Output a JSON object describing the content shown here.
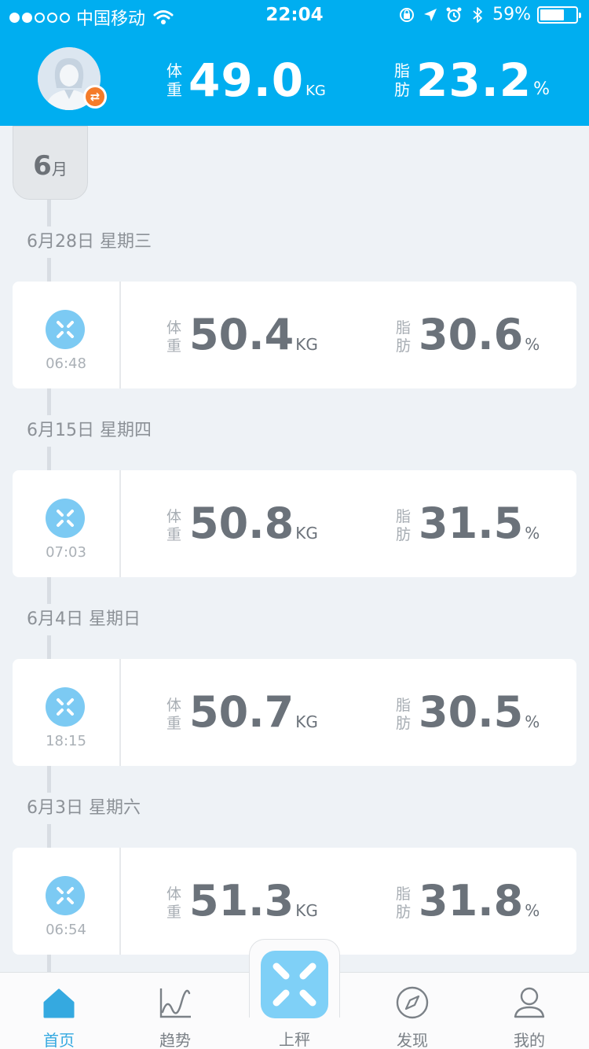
{
  "status_bar": {
    "carrier": "中国移动",
    "time": "22:04",
    "battery": "59%",
    "battery_level": 0.59,
    "signal_dots_on": 2,
    "signal_dots_total": 5
  },
  "header": {
    "weight_label_1": "体",
    "weight_label_2": "重",
    "weight_value": "49.0",
    "weight_unit": "KG",
    "fat_label_1": "脂",
    "fat_label_2": "肪",
    "fat_value": "23.2",
    "fat_unit": "%",
    "switch_icon": "swap-icon"
  },
  "timeline": {
    "month_number": "6",
    "month_unit": "月",
    "records": [
      {
        "date": "6月28日  星期三",
        "time": "06:48",
        "weight": "50.4",
        "fat": "30.6"
      },
      {
        "date": "6月15日  星期四",
        "time": "07:03",
        "weight": "50.8",
        "fat": "31.5"
      },
      {
        "date": "6月4日  星期日",
        "time": "18:15",
        "weight": "50.7",
        "fat": "30.5"
      },
      {
        "date": "6月3日  星期六",
        "time": "06:54",
        "weight": "51.3",
        "fat": "31.8"
      }
    ],
    "weight_label_1": "体",
    "weight_label_2": "重",
    "fat_label_1": "脂",
    "fat_label_2": "肪",
    "weight_unit": "KG",
    "fat_unit": "%"
  },
  "tabbar": {
    "tabs": [
      {
        "label": "首页",
        "icon": "home-icon",
        "active": true
      },
      {
        "label": "趋势",
        "icon": "trend-chart-icon",
        "active": false
      },
      {
        "label": "上秤",
        "icon": "scale-icon",
        "active": false
      },
      {
        "label": "发现",
        "icon": "compass-icon",
        "active": false
      },
      {
        "label": "我的",
        "icon": "profile-icon",
        "active": false
      }
    ]
  },
  "colors": {
    "brand_blue": "#00aef0",
    "accent_orange": "#f47b2a",
    "active_tab": "#35a9e0",
    "scale_icon_blue": "#7ccaf3"
  }
}
